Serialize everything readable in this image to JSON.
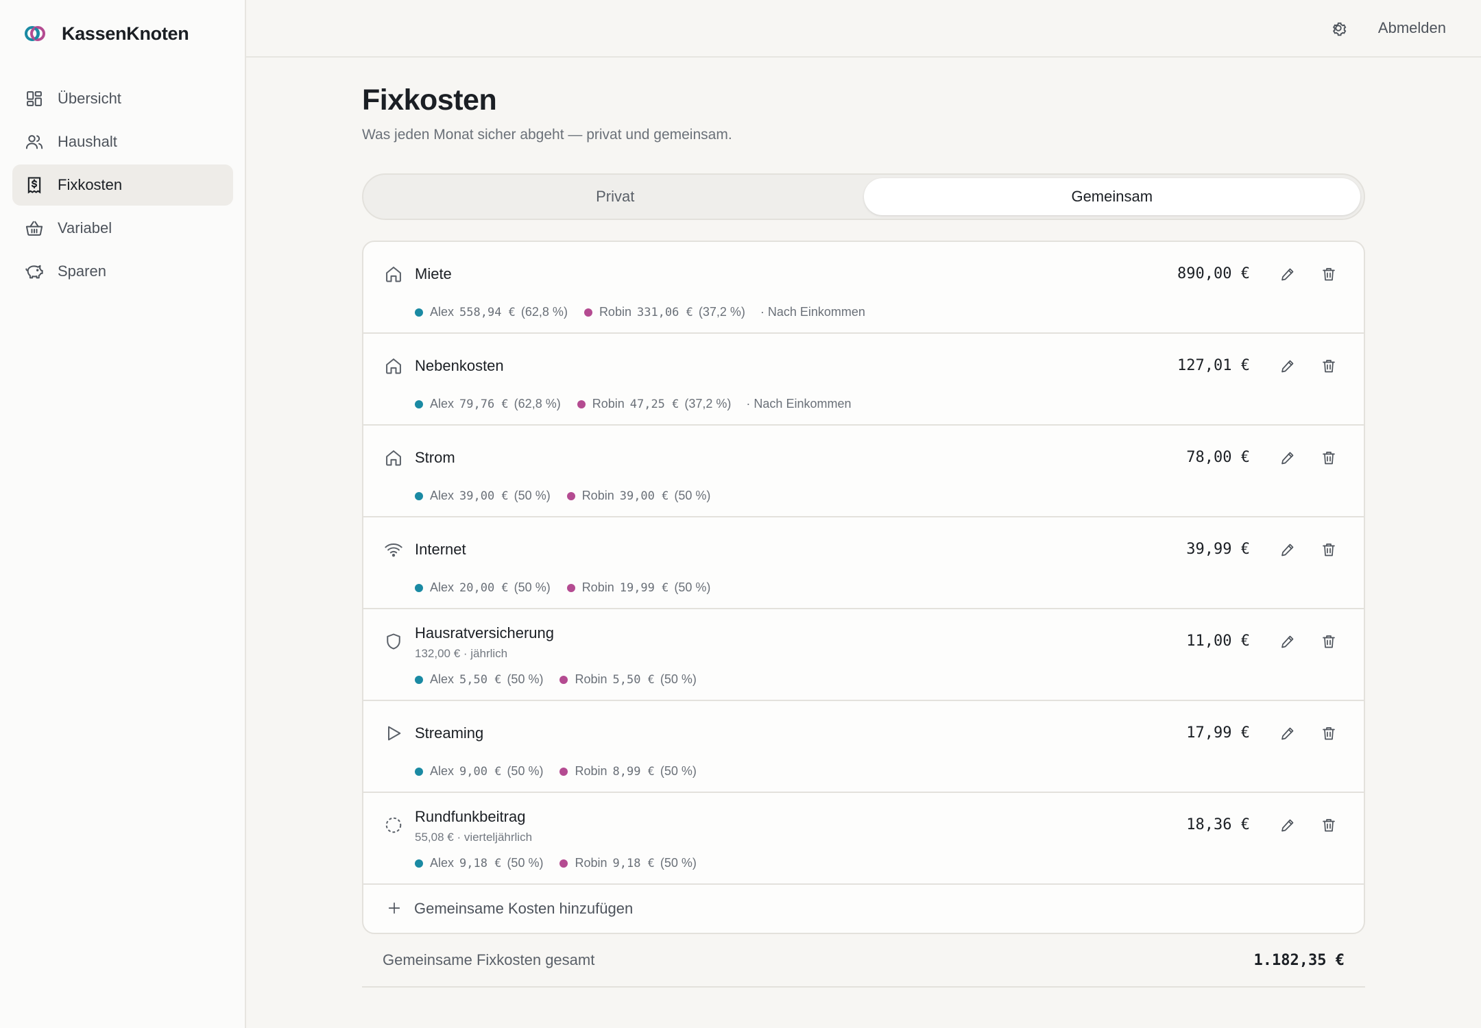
{
  "app": {
    "name": "KassenKnoten",
    "colors": {
      "accent_teal": "#1a8aa3",
      "accent_magenta": "#b44b91",
      "background": "#f7f6f3"
    }
  },
  "sidebar": {
    "items": [
      {
        "label": "Übersicht",
        "icon": "grid-icon"
      },
      {
        "label": "Haushalt",
        "icon": "users-icon"
      },
      {
        "label": "Fixkosten",
        "icon": "receipt-icon",
        "active": true
      },
      {
        "label": "Variabel",
        "icon": "basket-icon"
      },
      {
        "label": "Sparen",
        "icon": "piggy-bank-icon"
      }
    ]
  },
  "topbar": {
    "settings_icon": "gear-icon",
    "logout_label": "Abmelden"
  },
  "page": {
    "title": "Fixkosten",
    "subtitle": "Was jeden Monat sicher abgeht — privat und gemeinsam."
  },
  "tabs": [
    {
      "label": "Privat",
      "active": false
    },
    {
      "label": "Gemeinsam",
      "active": true
    }
  ],
  "costs": [
    {
      "name": "Miete",
      "icon": "home-icon",
      "amount": "890,00 €",
      "sub": "",
      "alex": {
        "name": "Alex",
        "amount": "558,94 €",
        "pct": "(62,8 %)"
      },
      "robin": {
        "name": "Robin",
        "amount": "331,06 €",
        "pct": "(37,2 %)"
      },
      "method": "· Nach Einkommen"
    },
    {
      "name": "Nebenkosten",
      "icon": "home-icon",
      "amount": "127,01 €",
      "sub": "",
      "alex": {
        "name": "Alex",
        "amount": "79,76 €",
        "pct": "(62,8 %)"
      },
      "robin": {
        "name": "Robin",
        "amount": "47,25 €",
        "pct": "(37,2 %)"
      },
      "method": "· Nach Einkommen"
    },
    {
      "name": "Strom",
      "icon": "home-icon",
      "amount": "78,00 €",
      "sub": "",
      "alex": {
        "name": "Alex",
        "amount": "39,00 €",
        "pct": "(50 %)"
      },
      "robin": {
        "name": "Robin",
        "amount": "39,00 €",
        "pct": "(50 %)"
      },
      "method": ""
    },
    {
      "name": "Internet",
      "icon": "wifi-icon",
      "amount": "39,99 €",
      "sub": "",
      "alex": {
        "name": "Alex",
        "amount": "20,00 €",
        "pct": "(50 %)"
      },
      "robin": {
        "name": "Robin",
        "amount": "19,99 €",
        "pct": "(50 %)"
      },
      "method": ""
    },
    {
      "name": "Hausratversicherung",
      "icon": "shield-icon",
      "amount": "11,00 €",
      "sub": "132,00 € · jährlich",
      "alex": {
        "name": "Alex",
        "amount": "5,50 €",
        "pct": "(50 %)"
      },
      "robin": {
        "name": "Robin",
        "amount": "5,50 €",
        "pct": "(50 %)"
      },
      "method": ""
    },
    {
      "name": "Streaming",
      "icon": "play-icon",
      "amount": "17,99 €",
      "sub": "",
      "alex": {
        "name": "Alex",
        "amount": "9,00 €",
        "pct": "(50 %)"
      },
      "robin": {
        "name": "Robin",
        "amount": "8,99 €",
        "pct": "(50 %)"
      },
      "method": ""
    },
    {
      "name": "Rundfunkbeitrag",
      "icon": "dashed-circle-icon",
      "amount": "18,36 €",
      "sub": "55,08 € · vierteljährlich",
      "alex": {
        "name": "Alex",
        "amount": "9,18 €",
        "pct": "(50 %)"
      },
      "robin": {
        "name": "Robin",
        "amount": "9,18 €",
        "pct": "(50 %)"
      },
      "method": ""
    }
  ],
  "add_label": "Gemeinsame Kosten hinzufügen",
  "total": {
    "label": "Gemeinsame Fixkosten gesamt",
    "value": "1.182,35 €"
  }
}
